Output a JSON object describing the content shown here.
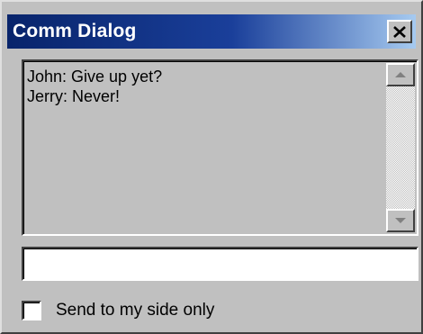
{
  "window": {
    "title": "Comm Dialog",
    "close_icon": "close-icon",
    "title_bar_color_start": "#08246b",
    "title_bar_color_end": "#a6caf0",
    "face_color": "#c0c0c0"
  },
  "chat": {
    "messages": [
      "John: Give up yet?",
      "Jerry: Never!"
    ],
    "scroll_up_icon": "scroll-up-arrow-icon",
    "scroll_down_icon": "scroll-down-arrow-icon"
  },
  "message_input": {
    "value": "",
    "placeholder": ""
  },
  "options": {
    "send_to_my_side_only_label": "Send to my side only",
    "send_to_my_side_only_checked": false
  }
}
